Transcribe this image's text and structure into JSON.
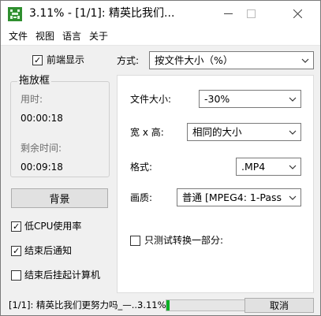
{
  "window": {
    "title": "3.11% - [1/1]: 精英比我们..."
  },
  "menu": [
    "文件",
    "视图",
    "语言",
    "关于"
  ],
  "left": {
    "topmost_label": "前端显示",
    "topmost_checked": true,
    "group_title": "拖放框",
    "elapsed_label": "用时:",
    "elapsed_value": "00:00:18",
    "remaining_label": "剩余时间:",
    "remaining_value": "00:09:18",
    "background_button": "背景",
    "options": [
      {
        "label": "低CPU使用率",
        "checked": true
      },
      {
        "label": "结束后通知",
        "checked": true
      },
      {
        "label": "结束后挂起计算机",
        "checked": false
      }
    ]
  },
  "mode": {
    "label": "方式:",
    "value": "按文件大小（%）"
  },
  "settings": {
    "filesize_label": "文件大小:",
    "filesize_value": "-30%",
    "dims_label": "宽 x 高:",
    "dims_value": "相同的大小",
    "format_label": "格式:",
    "format_value": ".MP4",
    "quality_label": "画质:",
    "quality_value": "普通  [MPEG4: 1-Pass",
    "test_part_label": "只测试转换一部分:",
    "test_part_checked": false
  },
  "status": {
    "text": "[1/1]: 精英比我们更努力吗_—...",
    "percent_text": "3.11%",
    "progress": 0.0311,
    "cancel_button": "取消"
  },
  "colors": {
    "progress": "#06b025",
    "titlebar": "#ffffff",
    "window_bg": "#f0f0f0"
  }
}
